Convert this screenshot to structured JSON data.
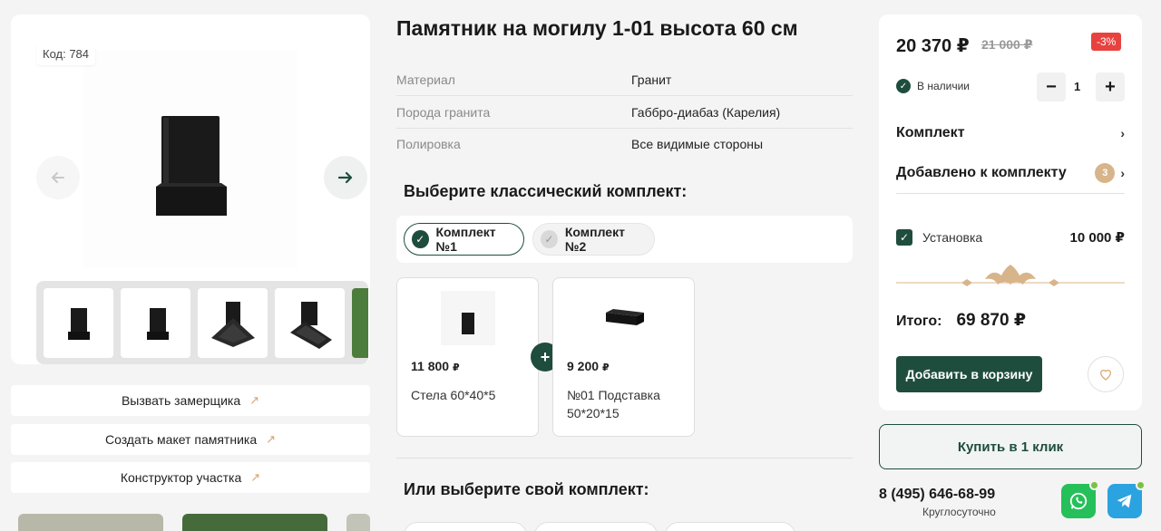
{
  "product": {
    "code_label": "Код: 784",
    "title": "Памятник на могилу 1-01 высота 60 см"
  },
  "specs": [
    {
      "key": "Материал",
      "value": "Гранит"
    },
    {
      "key": "Порода гранита",
      "value": "Габбро-диабаз (Карелия)"
    },
    {
      "key": "Полировка",
      "value": "Все видимые стороны"
    }
  ],
  "side_links": [
    {
      "label": "Вызвать замерщика"
    },
    {
      "label": "Создать макет памятника"
    },
    {
      "label": "Конструктор участка"
    }
  ],
  "kit_section": {
    "title": "Выберите классический комплект:",
    "tabs": [
      {
        "label": "Комплект №1",
        "selected": true
      },
      {
        "label": "Комплект №2",
        "selected": false
      }
    ],
    "items": [
      {
        "price": "11 800",
        "currency": "₽",
        "name": "Стела 60*40*5"
      },
      {
        "price": "9 200",
        "currency": "₽",
        "name": "№01 Подставка 50*20*15"
      }
    ],
    "plus": "+"
  },
  "custom_section": {
    "title": "Или выберите свой комплект:"
  },
  "order": {
    "price_now": "20 370 ₽",
    "price_old": "21 000 ₽",
    "discount": "-3%",
    "stock_label": "В наличии",
    "qty": "1",
    "qty_minus": "−",
    "qty_plus": "+",
    "kit_label": "Комплект",
    "added_label": "Добавлено к комплекту",
    "added_count": "3",
    "install_label": "Установка",
    "install_price": "10 000 ₽",
    "total_label": "Итого:",
    "total_value": "69 870 ₽",
    "cart_button": "Добавить в корзину"
  },
  "buy_one_click": "Купить в 1 клик",
  "contacts": {
    "phone": "8 (495) 646-68-99",
    "hours": "Круглосуточно"
  },
  "colors": {
    "accent": "#1f4d3d",
    "gold": "#d8a36c",
    "discount": "#e8423f",
    "whatsapp": "#25c05a",
    "telegram": "#2aa3e0"
  },
  "icons": [
    "arrow-left-icon",
    "arrow-right-icon",
    "external-link-icon",
    "check-icon",
    "chevron-right-icon",
    "heart-icon",
    "whatsapp-icon",
    "telegram-icon"
  ]
}
